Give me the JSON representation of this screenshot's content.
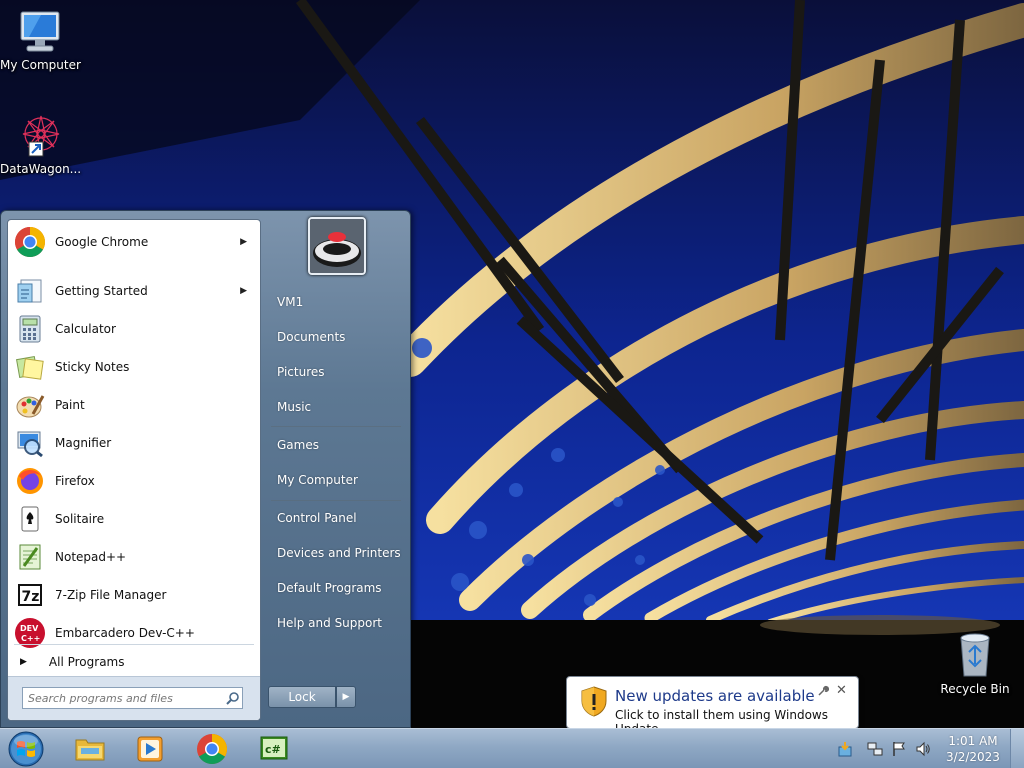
{
  "desktop": {
    "icons": [
      {
        "label": "My Computer",
        "icon": "computer-icon"
      },
      {
        "label": "DataWagon...",
        "icon": "datawagon-icon"
      },
      {
        "label": "Recycle Bin",
        "icon": "recycle-bin-icon"
      }
    ]
  },
  "start_menu": {
    "programs": [
      {
        "label": "Google Chrome",
        "icon": "chrome-icon",
        "has_submenu": true
      },
      {
        "label": "Getting Started",
        "icon": "getting-started-icon",
        "has_submenu": true
      },
      {
        "label": "Calculator",
        "icon": "calculator-icon",
        "has_submenu": false
      },
      {
        "label": "Sticky Notes",
        "icon": "sticky-notes-icon",
        "has_submenu": false
      },
      {
        "label": "Paint",
        "icon": "paint-icon",
        "has_submenu": false
      },
      {
        "label": "Magnifier",
        "icon": "magnifier-icon",
        "has_submenu": false
      },
      {
        "label": "Firefox",
        "icon": "firefox-icon",
        "has_submenu": false
      },
      {
        "label": "Solitaire",
        "icon": "solitaire-icon",
        "has_submenu": false
      },
      {
        "label": "Notepad++",
        "icon": "notepadpp-icon",
        "has_submenu": false
      },
      {
        "label": "7-Zip File Manager",
        "icon": "7zip-icon",
        "has_submenu": false
      },
      {
        "label": "Embarcadero Dev-C++",
        "icon": "devcpp-icon",
        "has_submenu": false
      }
    ],
    "all_programs": "All Programs",
    "search_placeholder": "Search programs and files",
    "right_items": [
      "VM1",
      "Documents",
      "Pictures",
      "Music",
      "Games",
      "My Computer",
      "Control Panel",
      "Devices and Printers",
      "Default Programs",
      "Help and Support"
    ],
    "lock_label": "Lock"
  },
  "taskbar": {
    "pinned": [
      "explorer-icon",
      "media-player-icon",
      "chrome-icon",
      "csharp-icon"
    ],
    "clock_time": "1:01 AM",
    "clock_date": "3/2/2023"
  },
  "notification": {
    "title": "New updates are available",
    "text": "Click to install them using Windows Update."
  },
  "colors": {
    "taskbar": "#8fa8c4",
    "start_menu_right": "#5d7893",
    "balloon_title": "#1e3a8a",
    "sky": "#0b1a6e"
  }
}
